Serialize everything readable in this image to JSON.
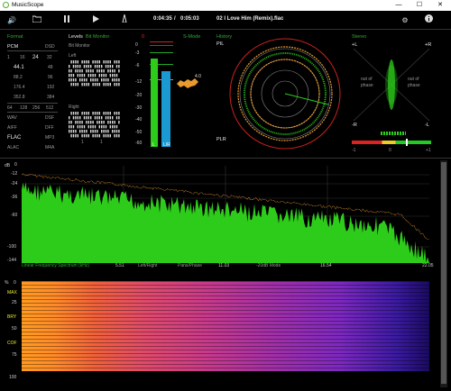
{
  "app": {
    "title": "MusicScope"
  },
  "window": {
    "minimize": "—",
    "maximize": "☐",
    "close": "✕"
  },
  "toolbar": {
    "elapsed": "0:04:35",
    "sep": "/",
    "total": "0:05:03",
    "track": "02 I Love Him (Remix).flac"
  },
  "format": {
    "title": "Format",
    "type_left": "PCM",
    "type_right": "DSD",
    "depths": [
      "1",
      "16",
      "24",
      "32"
    ],
    "depth_selected": "24",
    "rates_left": [
      "44.1",
      "88.2",
      "176.4",
      "352.8"
    ],
    "rates_right": [
      "48",
      "96",
      "192",
      "384"
    ],
    "rates_selected": "44.1",
    "dsd": [
      "64",
      "128",
      "256",
      "512"
    ],
    "containers": [
      [
        "WAV",
        "DSF"
      ],
      [
        "AIFF",
        "DFF"
      ],
      [
        "FLAC",
        "MP3"
      ],
      [
        "ALAC",
        "M4A"
      ]
    ],
    "container_selected": "FLAC"
  },
  "levels": {
    "title": "Levels",
    "bit_monitor": "Bit Monitor",
    "bit_monitor_sub": "Bit Monitor",
    "left": "Left",
    "right": "Right",
    "ticks_bottom": [
      "1",
      "1"
    ]
  },
  "meter": {
    "left_label": "0",
    "right_label": "S-Mode",
    "scale": [
      "0",
      "-3",
      "-6",
      "-12",
      "-20",
      "-30",
      "-40",
      "-50",
      "-60"
    ],
    "peak_value": "4.0",
    "ch_l": "L",
    "ch_r": "L/R",
    "level_l": 0.84,
    "level_r": 0.72
  },
  "history": {
    "title": "History",
    "pl": "PIL",
    "plr": "PLR"
  },
  "stereo": {
    "title": "Stereo",
    "l_plus": "+L",
    "r_plus": "+R",
    "l_minus": "-L",
    "r_minus": "-R",
    "out_of_phase": "out of phase",
    "corr_left": "-1",
    "corr_mid": "0",
    "corr_right": "+1"
  },
  "spectrum": {
    "ylabel": "dB",
    "yticks": [
      "0",
      "-12",
      "-24",
      "-36",
      "-60",
      "-100",
      "-144"
    ],
    "xlabel": "Linear Frequency Spectrum (kHz)",
    "xticks": [
      "5.51",
      "11.03",
      "16.54",
      "22.05"
    ],
    "mode_labels": [
      "Left/Right",
      "Pans/Phase",
      "-20dB Mode"
    ]
  },
  "spectrogram": {
    "ylabel": "%",
    "yticks": [
      "0",
      "25",
      "50",
      "75",
      "100"
    ],
    "labels": [
      "MAX",
      "BRY",
      "COF"
    ]
  },
  "colors": {
    "green": "#2ecc1a",
    "accent": "#38b000",
    "orange": "#e89a30",
    "red": "#e23",
    "cyan": "#1a9ad0"
  }
}
